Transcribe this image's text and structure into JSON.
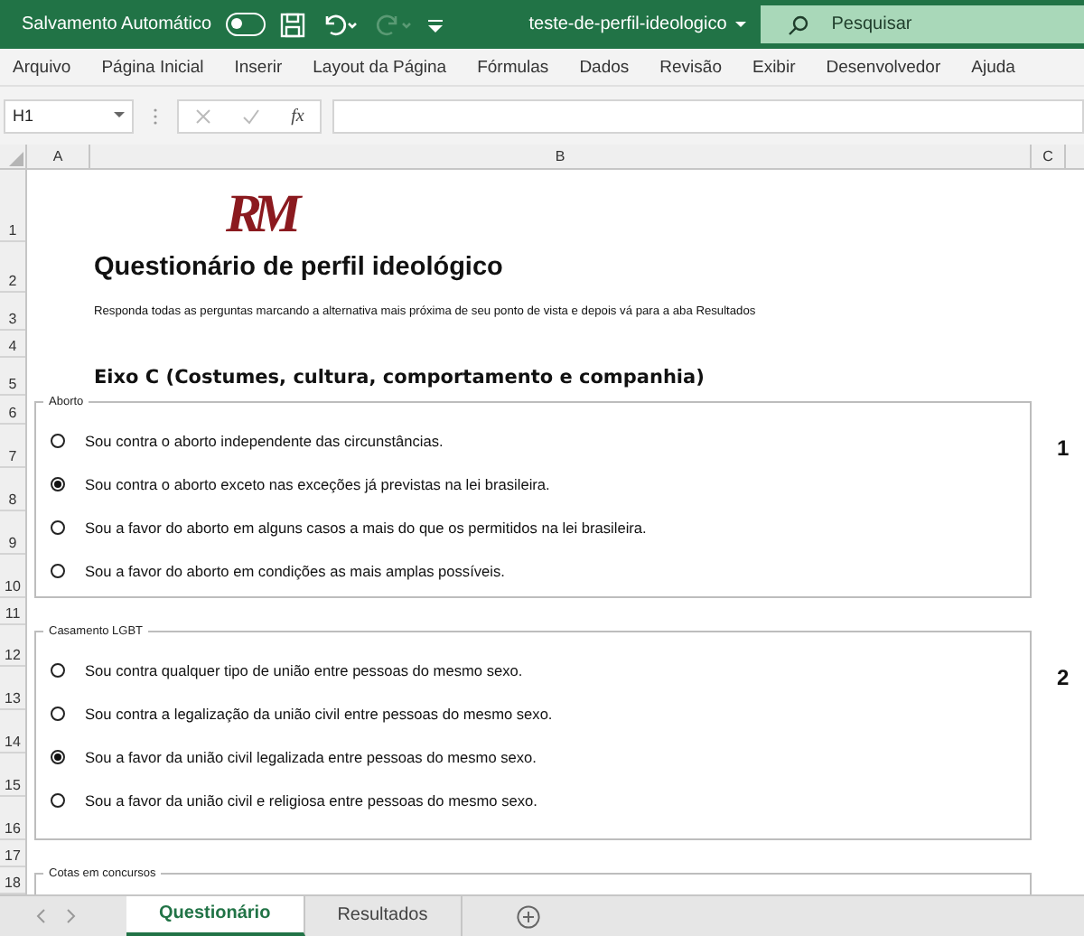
{
  "title_bar": {
    "autosave_label": "Salvamento Automático",
    "autosave_on": false,
    "file_name": "teste-de-perfil-ideologico",
    "search_placeholder": "Pesquisar"
  },
  "menu": [
    "Arquivo",
    "Página Inicial",
    "Inserir",
    "Layout da Página",
    "Fórmulas",
    "Dados",
    "Revisão",
    "Exibir",
    "Desenvolvedor",
    "Ajuda"
  ],
  "formula_bar": {
    "name_box": "H1",
    "function_label": "fx"
  },
  "columns": [
    "A",
    "B",
    "C"
  ],
  "rows": [
    "1",
    "2",
    "3",
    "4",
    "5",
    "6",
    "7",
    "8",
    "9",
    "10",
    "11",
    "12",
    "13",
    "14",
    "15",
    "16",
    "17",
    "18"
  ],
  "sheet": {
    "logo": "RM",
    "title": "Questionário de perfil ideológico",
    "subtitle": "Responda todas as perguntas marcando a alternativa mais próxima de seu ponto de vista e depois vá para a aba Resultados",
    "section": "Eixo C (Costumes, cultura, comportamento e companhia)",
    "groups": [
      {
        "label": "Aborto",
        "number": "1",
        "options": [
          {
            "text": "Sou contra o aborto independente das circunstâncias.",
            "selected": false
          },
          {
            "text": "Sou contra o aborto exceto nas exceções já previstas na lei brasileira.",
            "selected": true
          },
          {
            "text": "Sou a favor do aborto em alguns casos a mais do que os permitidos na lei brasileira.",
            "selected": false
          },
          {
            "text": "Sou a favor do aborto em condições as mais amplas possíveis.",
            "selected": false
          }
        ]
      },
      {
        "label": "Casamento LGBT",
        "number": "2",
        "options": [
          {
            "text": "Sou contra qualquer tipo de união entre pessoas do mesmo sexo.",
            "selected": false
          },
          {
            "text": "Sou contra a legalização da união civil entre pessoas do mesmo sexo.",
            "selected": false
          },
          {
            "text": "Sou a favor da união civil legalizada entre pessoas do mesmo sexo.",
            "selected": true
          },
          {
            "text": "Sou a favor da união civil e religiosa entre pessoas do mesmo sexo.",
            "selected": false
          }
        ]
      },
      {
        "label": "Cotas em concursos"
      }
    ]
  },
  "sheet_tabs": [
    {
      "label": "Questionário",
      "selected": true
    },
    {
      "label": "Resultados",
      "selected": false
    }
  ]
}
